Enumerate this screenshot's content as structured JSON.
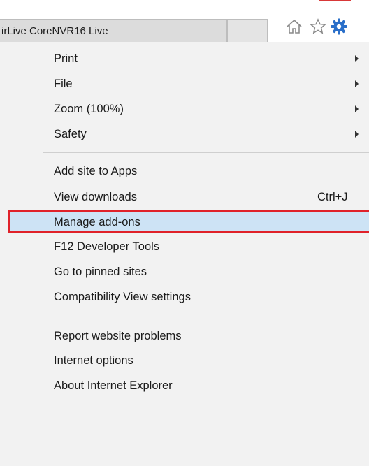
{
  "browser": {
    "tab_title": "irLive CoreNVR16 Live",
    "icons": [
      "home-icon",
      "star-icon",
      "gear-icon"
    ]
  },
  "menu": {
    "groups": [
      {
        "items": [
          {
            "label": "Print",
            "submenu": true
          },
          {
            "label": "File",
            "submenu": true
          },
          {
            "label": "Zoom (100%)",
            "submenu": true
          },
          {
            "label": "Safety",
            "submenu": true
          }
        ]
      },
      {
        "items": [
          {
            "label": "Add site to Apps"
          },
          {
            "label": "View downloads",
            "shortcut": "Ctrl+J"
          },
          {
            "label": "Manage add-ons",
            "highlighted": true
          },
          {
            "label": "F12 Developer Tools"
          },
          {
            "label": "Go to pinned sites"
          },
          {
            "label": "Compatibility View settings"
          }
        ]
      },
      {
        "items": [
          {
            "label": "Report website problems"
          },
          {
            "label": "Internet options"
          },
          {
            "label": "About Internet Explorer"
          }
        ]
      }
    ]
  },
  "colors": {
    "highlight_fill": "#cde3f5",
    "highlight_border": "#e0222a",
    "gear_blue": "#2a6fc9"
  }
}
